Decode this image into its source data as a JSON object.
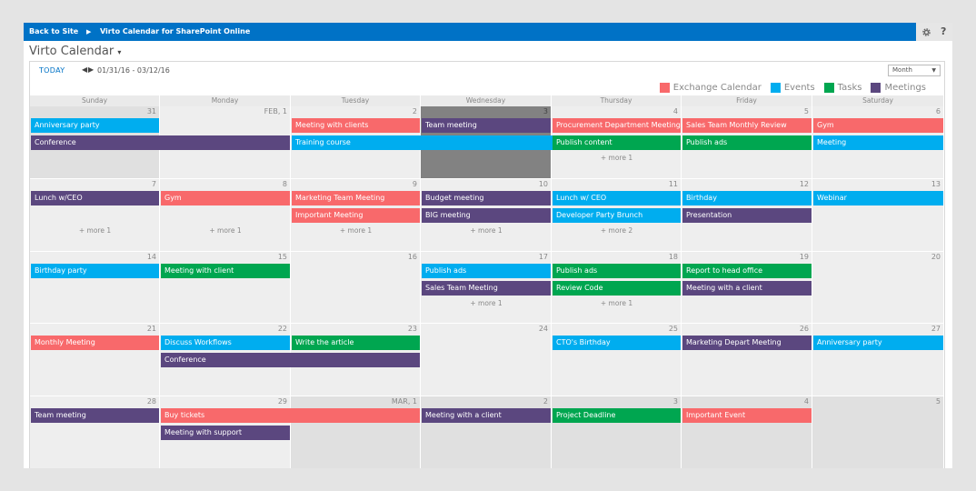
{
  "topbar": {
    "back_label": "Back to Site",
    "separator": "▶",
    "app_title": "Virto Calendar for SharePoint Online",
    "settings_icon": "gear-icon",
    "help_label": "?"
  },
  "page": {
    "title": "Virto Calendar",
    "title_caret": "▾"
  },
  "toolbar": {
    "today_label": "TODAY",
    "prev_glyph": "◀",
    "next_glyph": "▶",
    "date_range": "01/31/16 - 03/12/16",
    "view_selected": "Month",
    "view_caret": "▼"
  },
  "colors": {
    "exchange": "#f8696b",
    "events": "#00adef",
    "tasks": "#00a650",
    "meetings": "#5b477f"
  },
  "legend": [
    {
      "label": "Exchange Calendar",
      "color": "#f8696b"
    },
    {
      "label": "Events",
      "color": "#00adef"
    },
    {
      "label": "Tasks",
      "color": "#00a650"
    },
    {
      "label": "Meetings",
      "color": "#5b477f"
    }
  ],
  "days_of_week": [
    "Sunday",
    "Monday",
    "Tuesday",
    "Wednesday",
    "Thursday",
    "Friday",
    "Saturday"
  ],
  "weeks": [
    {
      "cells": [
        {
          "num": "31",
          "state": "dim"
        },
        {
          "num": "FEB, 1"
        },
        {
          "num": "2"
        },
        {
          "num": "3",
          "state": "today"
        },
        {
          "num": "4"
        },
        {
          "num": "5"
        },
        {
          "num": "6"
        }
      ]
    },
    {
      "cells": [
        {
          "num": "7"
        },
        {
          "num": "8"
        },
        {
          "num": "9"
        },
        {
          "num": "10"
        },
        {
          "num": "11"
        },
        {
          "num": "12"
        },
        {
          "num": "13"
        }
      ]
    },
    {
      "cells": [
        {
          "num": "14"
        },
        {
          "num": "15"
        },
        {
          "num": "16"
        },
        {
          "num": "17"
        },
        {
          "num": "18"
        },
        {
          "num": "19"
        },
        {
          "num": "20"
        }
      ]
    },
    {
      "cells": [
        {
          "num": "21"
        },
        {
          "num": "22"
        },
        {
          "num": "23"
        },
        {
          "num": "24"
        },
        {
          "num": "25"
        },
        {
          "num": "26"
        },
        {
          "num": "27"
        }
      ]
    },
    {
      "cells": [
        {
          "num": "28"
        },
        {
          "num": "29"
        },
        {
          "num": "MAR, 1",
          "state": "dim"
        },
        {
          "num": "2",
          "state": "dim"
        },
        {
          "num": "3",
          "state": "dim"
        },
        {
          "num": "4",
          "state": "dim"
        },
        {
          "num": "5",
          "state": "dim"
        }
      ]
    }
  ],
  "events": [
    {
      "week": 0,
      "day": 0,
      "span": 1,
      "slot": 0,
      "label": "Anniversary party",
      "type": "events"
    },
    {
      "week": 0,
      "day": 0,
      "span": 2,
      "slot": 1,
      "label": "Conference",
      "type": "meetings"
    },
    {
      "week": 0,
      "day": 2,
      "span": 1,
      "slot": 0,
      "label": "Meeting with clients",
      "type": "exchange"
    },
    {
      "week": 0,
      "day": 2,
      "span": 3,
      "slot": 1,
      "label": "Training course",
      "type": "events"
    },
    {
      "week": 0,
      "day": 3,
      "span": 1,
      "slot": 0,
      "label": "Team meeting",
      "type": "meetings"
    },
    {
      "week": 0,
      "day": 4,
      "span": 1,
      "slot": 0,
      "label": "Procurement Department Meeting",
      "type": "exchange"
    },
    {
      "week": 0,
      "day": 4,
      "span": 1,
      "slot": 1,
      "label": "Publish content",
      "type": "tasks"
    },
    {
      "week": 0,
      "day": 5,
      "span": 1,
      "slot": 0,
      "label": "Sales Team Monthly Review",
      "type": "exchange"
    },
    {
      "week": 0,
      "day": 5,
      "span": 1,
      "slot": 1,
      "label": "Publish ads",
      "type": "tasks"
    },
    {
      "week": 0,
      "day": 6,
      "span": 1,
      "slot": 0,
      "label": "Gym",
      "type": "exchange"
    },
    {
      "week": 0,
      "day": 6,
      "span": 1,
      "slot": 1,
      "label": "Meeting",
      "type": "events"
    },
    {
      "week": 1,
      "day": 0,
      "span": 1,
      "slot": 0,
      "label": "Lunch w/CEO",
      "type": "meetings"
    },
    {
      "week": 1,
      "day": 1,
      "span": 1,
      "slot": 0,
      "label": "Gym",
      "type": "exchange"
    },
    {
      "week": 1,
      "day": 2,
      "span": 1,
      "slot": 0,
      "label": "Marketing Team Meeting",
      "type": "exchange"
    },
    {
      "week": 1,
      "day": 2,
      "span": 1,
      "slot": 1,
      "label": "Important Meeting",
      "type": "exchange"
    },
    {
      "week": 1,
      "day": 3,
      "span": 1,
      "slot": 0,
      "label": "Budget meeting",
      "type": "meetings"
    },
    {
      "week": 1,
      "day": 3,
      "span": 1,
      "slot": 1,
      "label": "BIG meeting",
      "type": "meetings"
    },
    {
      "week": 1,
      "day": 4,
      "span": 1,
      "slot": 0,
      "label": "Lunch w/ CEO",
      "type": "events"
    },
    {
      "week": 1,
      "day": 4,
      "span": 1,
      "slot": 1,
      "label": "Developer Party Brunch",
      "type": "events"
    },
    {
      "week": 1,
      "day": 5,
      "span": 1,
      "slot": 0,
      "label": "Birthday",
      "type": "events"
    },
    {
      "week": 1,
      "day": 5,
      "span": 1,
      "slot": 1,
      "label": "Presentation",
      "type": "meetings"
    },
    {
      "week": 1,
      "day": 6,
      "span": 1,
      "slot": 0,
      "label": "Webinar",
      "type": "events"
    },
    {
      "week": 2,
      "day": 0,
      "span": 1,
      "slot": 0,
      "label": "Birthday party",
      "type": "events"
    },
    {
      "week": 2,
      "day": 1,
      "span": 1,
      "slot": 0,
      "label": "Meeting with client",
      "type": "tasks"
    },
    {
      "week": 2,
      "day": 3,
      "span": 1,
      "slot": 0,
      "label": "Publish ads",
      "type": "events"
    },
    {
      "week": 2,
      "day": 3,
      "span": 1,
      "slot": 1,
      "label": "Sales Team Meeting",
      "type": "meetings"
    },
    {
      "week": 2,
      "day": 4,
      "span": 1,
      "slot": 0,
      "label": "Publish ads",
      "type": "tasks"
    },
    {
      "week": 2,
      "day": 4,
      "span": 1,
      "slot": 1,
      "label": "Review Code",
      "type": "tasks"
    },
    {
      "week": 2,
      "day": 5,
      "span": 1,
      "slot": 0,
      "label": "Report to head office",
      "type": "tasks"
    },
    {
      "week": 2,
      "day": 5,
      "span": 1,
      "slot": 1,
      "label": "Meeting with a client",
      "type": "meetings"
    },
    {
      "week": 3,
      "day": 0,
      "span": 1,
      "slot": 0,
      "label": "Monthly Meeting",
      "type": "exchange"
    },
    {
      "week": 3,
      "day": 1,
      "span": 1,
      "slot": 0,
      "label": "Discuss Workflows",
      "type": "events"
    },
    {
      "week": 3,
      "day": 1,
      "span": 2,
      "slot": 1,
      "label": "Conference",
      "type": "meetings"
    },
    {
      "week": 3,
      "day": 2,
      "span": 1,
      "slot": 0,
      "label": "Write the article",
      "type": "tasks"
    },
    {
      "week": 3,
      "day": 4,
      "span": 1,
      "slot": 0,
      "label": "CTO's Birthday",
      "type": "events"
    },
    {
      "week": 3,
      "day": 5,
      "span": 1,
      "slot": 0,
      "label": "Marketing Depart Meeting",
      "type": "meetings"
    },
    {
      "week": 3,
      "day": 6,
      "span": 1,
      "slot": 0,
      "label": "Anniversary party",
      "type": "events"
    },
    {
      "week": 4,
      "day": 0,
      "span": 1,
      "slot": 0,
      "label": "Team meeting",
      "type": "meetings"
    },
    {
      "week": 4,
      "day": 1,
      "span": 2,
      "slot": 0,
      "label": "Buy tickets",
      "type": "exchange"
    },
    {
      "week": 4,
      "day": 1,
      "span": 1,
      "slot": 1,
      "label": "Meeting with support",
      "type": "meetings"
    },
    {
      "week": 4,
      "day": 3,
      "span": 1,
      "slot": 0,
      "label": "Meeting with a client",
      "type": "meetings"
    },
    {
      "week": 4,
      "day": 4,
      "span": 1,
      "slot": 0,
      "label": "Project Deadline",
      "type": "tasks"
    },
    {
      "week": 4,
      "day": 5,
      "span": 1,
      "slot": 0,
      "label": "Important Event",
      "type": "exchange"
    }
  ],
  "more_links": [
    {
      "week": 0,
      "day": 4,
      "label": "+ more 1"
    },
    {
      "week": 1,
      "day": 0,
      "label": "+ more 1"
    },
    {
      "week": 1,
      "day": 1,
      "label": "+ more 1"
    },
    {
      "week": 1,
      "day": 2,
      "label": "+ more 1"
    },
    {
      "week": 1,
      "day": 3,
      "label": "+ more 1"
    },
    {
      "week": 1,
      "day": 4,
      "label": "+ more 2"
    },
    {
      "week": 2,
      "day": 3,
      "label": "+ more 1"
    },
    {
      "week": 2,
      "day": 4,
      "label": "+ more 1"
    }
  ]
}
